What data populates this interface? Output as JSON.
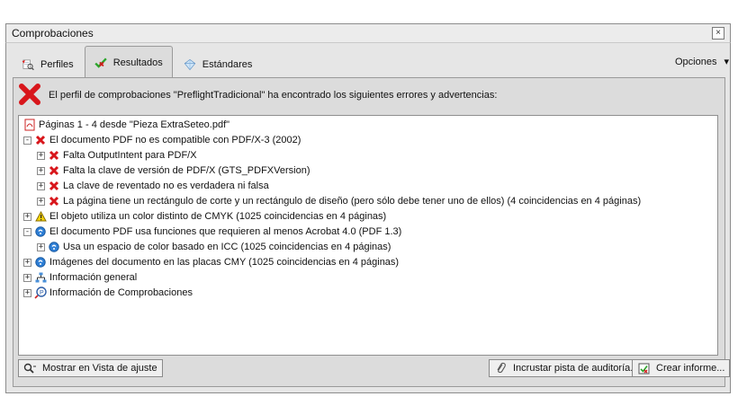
{
  "window": {
    "title": "Comprobaciones",
    "close_label": "×"
  },
  "tabs": [
    {
      "label": "Perfiles",
      "icon": "profiles-icon"
    },
    {
      "label": "Resultados",
      "icon": "check-icon"
    },
    {
      "label": "Estándares",
      "icon": "crystal-icon"
    }
  ],
  "options": {
    "label": "Opciones",
    "arrow": "▾"
  },
  "message": "El perfil de comprobaciones \"PreflightTradicional\" ha encontrado los siguientes errores y advertencias:",
  "tree": [
    {
      "label": "Páginas 1 - 4 desde \"Pieza ExtraSeteo.pdf\"",
      "icon": "pdf-icon",
      "expand": "-"
    },
    {
      "label": "El documento PDF no es compatible con PDF/X-3 (2002)",
      "icon": "red-x-icon",
      "expand": "-"
    },
    {
      "label": "Falta OutputIntent para PDF/X",
      "icon": "red-x-icon",
      "expand": "+"
    },
    {
      "label": "Falta la clave de versión de PDF/X (GTS_PDFXVersion)",
      "icon": "red-x-icon",
      "expand": "+"
    },
    {
      "label": "La clave de reventado no es verdadera ni falsa",
      "icon": "red-x-icon",
      "expand": "+"
    },
    {
      "label": "La página tiene un rectángulo de corte y un rectángulo de diseño (pero sólo debe tener uno de ellos) (4 coincidencias en 4 páginas)",
      "icon": "red-x-icon",
      "expand": "+"
    },
    {
      "label": "El objeto utiliza un color distinto de CMYK (1025 coincidencias en 4 páginas)",
      "icon": "warning-icon",
      "expand": "+"
    },
    {
      "label": "El documento PDF usa funciones que requieren al menos Acrobat 4.0 (PDF 1.3)",
      "icon": "info-icon",
      "expand": "-"
    },
    {
      "label": "Usa un espacio de color basado en ICC (1025 coincidencias en 4 páginas)",
      "icon": "info-icon",
      "expand": "+"
    },
    {
      "label": "Imágenes del documento en las placas CMY (1025 coincidencias en 4 páginas)",
      "icon": "info-icon",
      "expand": "+"
    },
    {
      "label": "Información general",
      "icon": "structure-icon",
      "expand": "+"
    },
    {
      "label": "Información de Comprobaciones",
      "icon": "preflight-info-icon",
      "expand": "+"
    }
  ],
  "buttons": {
    "show_in_fit": "Mostrar en Vista de ajuste",
    "embed_audit": "Incrustar pista de auditoría...",
    "create_report": "Crear informe..."
  }
}
